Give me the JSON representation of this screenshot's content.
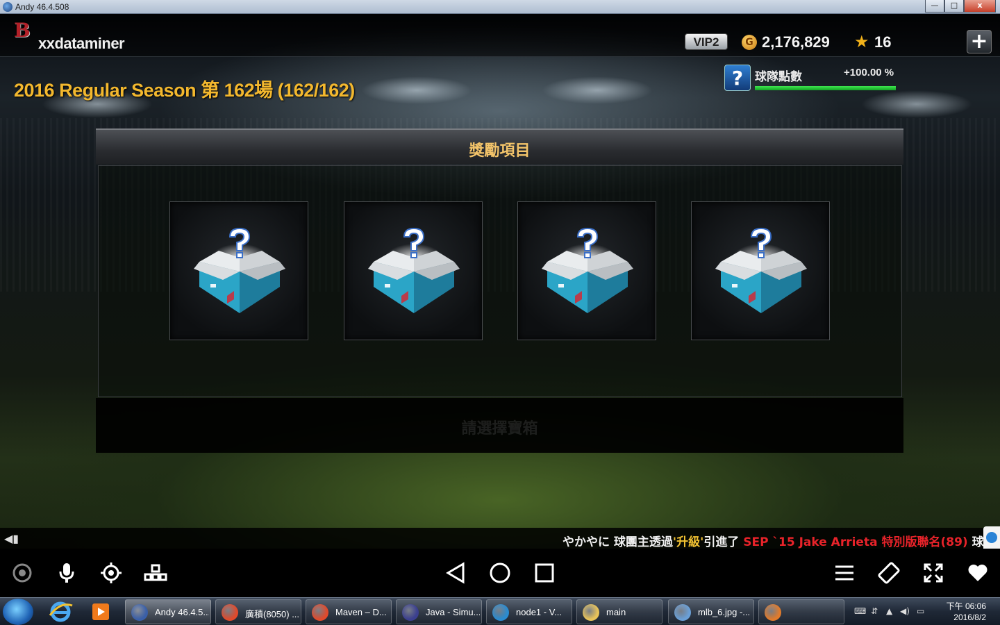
{
  "window": {
    "title": "Andy 46.4.508",
    "buttons": {
      "minimize": "—",
      "maximize": "□",
      "close": "x"
    }
  },
  "header": {
    "team_logo": "B",
    "username": "xxdataminer",
    "vip": "VIP2",
    "coin_icon": "G",
    "coins": "2,176,829",
    "stars": "16",
    "plus": "+"
  },
  "season": {
    "title": "2016 Regular Season 第 162場 (162/162)"
  },
  "team_points": {
    "icon": "?",
    "label": "球隊點數",
    "value": "+100.00 %",
    "progress": 1.0
  },
  "reward_panel": {
    "title": "獎勵項目",
    "footer_label": "請選擇寶箱",
    "cards": [
      {
        "icon": "mystery-box-icon"
      },
      {
        "icon": "mystery-box-icon"
      },
      {
        "icon": "mystery-box-icon"
      },
      {
        "icon": "mystery-box-icon"
      }
    ]
  },
  "ticker": {
    "parts": [
      {
        "text": "やかやに 球團主透過",
        "color": "white"
      },
      {
        "text": "'升級'",
        "color": "yellow"
      },
      {
        "text": "引進了 ",
        "color": "white"
      },
      {
        "text": "SEP `15 Jake Arrieta 特別版聯名(89)",
        "color": "red"
      },
      {
        "text": " 球員",
        "color": "white"
      }
    ]
  },
  "android_bar": {
    "left": [
      "camera-icon",
      "microphone-icon",
      "location-icon",
      "apps-icon"
    ],
    "center": [
      "back-icon",
      "home-icon",
      "recents-icon"
    ],
    "right": [
      "menu-icon",
      "rotate-icon",
      "fullscreen-icon",
      "heart-icon"
    ]
  },
  "taskbar": {
    "items": [
      {
        "label": "Andy 46.4.5...",
        "color": "#3a5fa8"
      },
      {
        "label": "廣積(8050) ...",
        "color": "#e04a2c"
      },
      {
        "label": "Maven – D...",
        "color": "#e04a2c"
      },
      {
        "label": "Java - Simu...",
        "color": "#3b3f8f"
      },
      {
        "label": "node1 - V...",
        "color": "#2a8bd0"
      },
      {
        "label": "main",
        "color": "#e8c35a"
      },
      {
        "label": "mlb_6.jpg -...",
        "color": "#6a9fd6"
      },
      {
        "label": "",
        "color": "#e07b2c"
      }
    ],
    "clock_time": "下午 06:06",
    "clock_date": "2016/8/2"
  }
}
